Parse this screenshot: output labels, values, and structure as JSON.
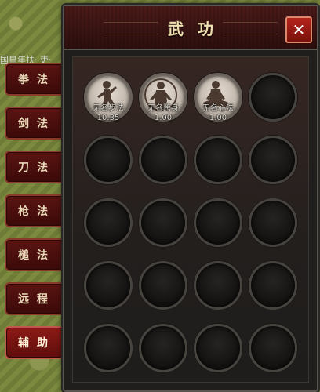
{
  "panel": {
    "title": "武功",
    "close_label": "✕"
  },
  "background_text": "国皇年扶·\n吏·",
  "tabs": [
    {
      "label": "拳法",
      "active": false
    },
    {
      "label": "剑法",
      "active": false
    },
    {
      "label": "刀法",
      "active": false
    },
    {
      "label": "枪法",
      "active": false
    },
    {
      "label": "槌法",
      "active": false
    },
    {
      "label": "远程",
      "active": false
    },
    {
      "label": "辅助",
      "active": true
    }
  ],
  "skills": [
    {
      "name": "无名步法",
      "level": "10.35",
      "icon": "stepping-figure-icon"
    },
    {
      "name": "无名跨身",
      "level": "1.00",
      "icon": "body-figure-icon"
    },
    {
      "name": "无名心法",
      "level": "1.00",
      "icon": "meditation-figure-icon"
    }
  ],
  "grid": {
    "rows": 5,
    "cols": 4
  }
}
